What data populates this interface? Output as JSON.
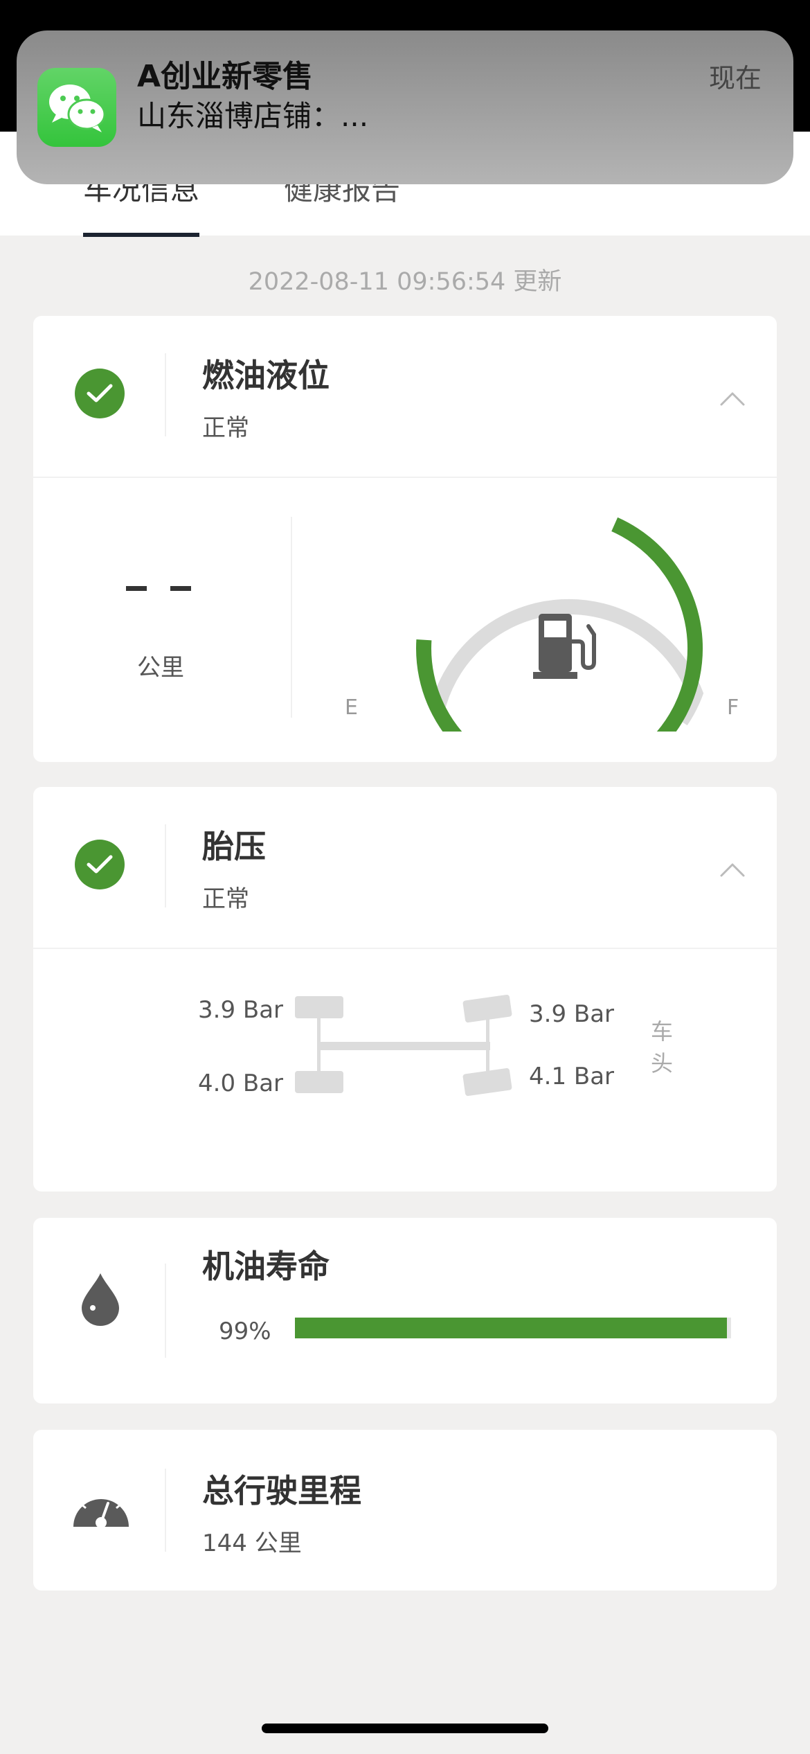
{
  "tabs": [
    {
      "label": "车况信息",
      "active": true
    },
    {
      "label": "健康报告",
      "active": false
    }
  ],
  "update_time": "2022-08-11 09:56:54 更新",
  "fuel": {
    "title": "燃油液位",
    "status": "正常",
    "range_value": "- -",
    "range_unit": "公里",
    "gauge_label_empty": "E",
    "gauge_label_full": "F",
    "gauge_level": 0.8,
    "icon": "fuel-pump-icon"
  },
  "tire": {
    "title": "胎压",
    "status": "正常",
    "rear_left": "3.9 Bar",
    "rear_right": "4.0 Bar",
    "front_left": "3.9 Bar",
    "front_right": "4.1 Bar",
    "car_head": "车头"
  },
  "oil": {
    "title": "机油寿命",
    "percent_text": "99%",
    "percent": 99,
    "icon": "oil-drop-icon"
  },
  "mileage": {
    "title": "总行驶里程",
    "value": "144 公里",
    "icon": "speedometer-icon"
  },
  "notification": {
    "app_icon": "wechat-icon",
    "title": "A创业新零售",
    "body": "山东淄博店铺：...",
    "time": "现在"
  },
  "colors": {
    "accent_green": "#4a9632",
    "gauge_track": "#dcdcdc"
  }
}
